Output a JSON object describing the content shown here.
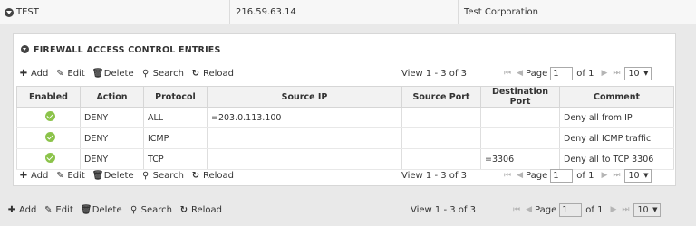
{
  "parent_row": {
    "name": "TEST",
    "ip": "216.59.63.14",
    "company": "Test Corporation"
  },
  "panel": {
    "title": "FIREWALL ACCESS CONTROL ENTRIES"
  },
  "toolbar": {
    "add": "Add",
    "edit": "Edit",
    "delete": "Delete",
    "search": "Search",
    "reload": "Reload"
  },
  "pager": {
    "view_text": "View 1 - 3 of 3",
    "page_label": "Page",
    "page_value": "1",
    "of_text": "of 1",
    "rows_per_page": "10"
  },
  "table": {
    "columns": [
      "Enabled",
      "Action",
      "Protocol",
      "Source IP",
      "Source Port",
      "Destination Port",
      "Comment"
    ],
    "rows": [
      {
        "enabled": true,
        "action": "DENY",
        "protocol": "ALL",
        "source_ip": "=203.0.113.100",
        "source_port": "",
        "dest_port": "",
        "comment": "Deny all from IP"
      },
      {
        "enabled": true,
        "action": "DENY",
        "protocol": "ICMP",
        "source_ip": "",
        "source_port": "",
        "dest_port": "",
        "comment": "Deny all ICMP traffic"
      },
      {
        "enabled": true,
        "action": "DENY",
        "protocol": "TCP",
        "source_ip": "",
        "source_port": "",
        "dest_port": "=3306",
        "comment": "Deny all to TCP 3306"
      }
    ]
  },
  "colors": {
    "enabled_check": "#8bc34a",
    "page_bg": "#e9e9e9",
    "panel_bg": "#ffffff",
    "header_bg": "#f2f2f2"
  }
}
